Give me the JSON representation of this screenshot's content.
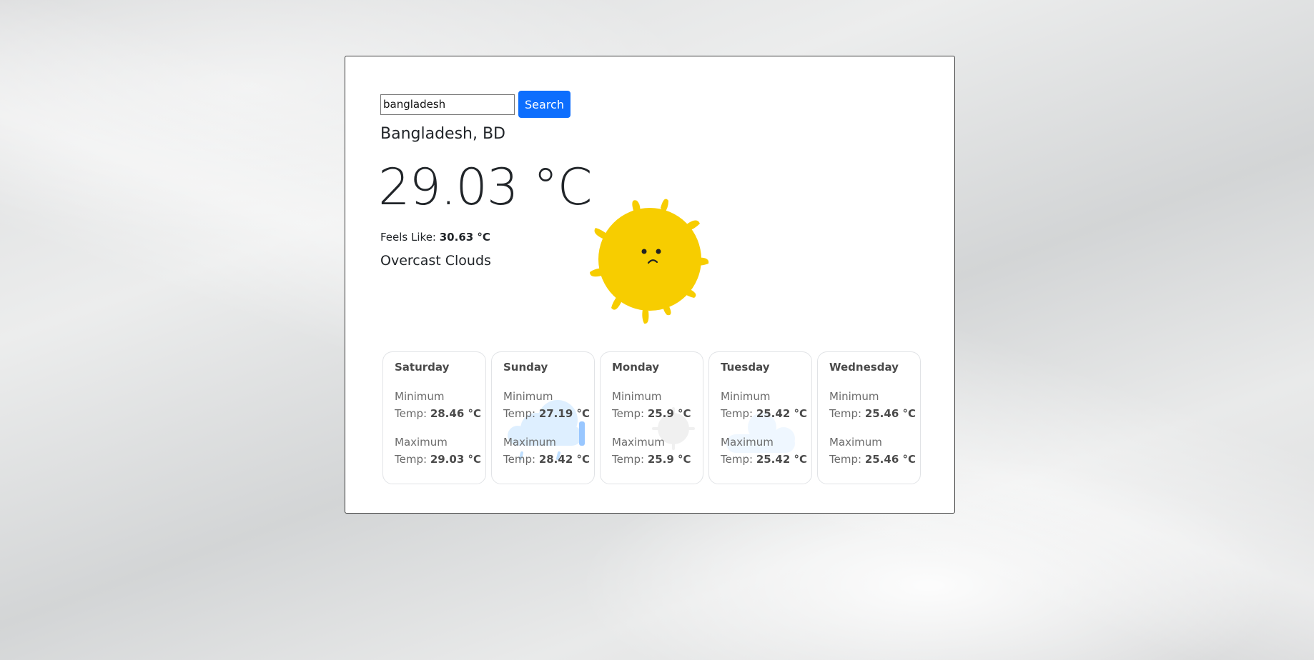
{
  "search": {
    "value": "bangladesh",
    "button_label": "Search"
  },
  "current": {
    "location": "Bangladesh, BD",
    "temperature": "29.03 °C",
    "feels_like_label": "Feels Like: ",
    "feels_like_value": "30.63 °C",
    "description": "Overcast Clouds",
    "icon": "sad-sun-icon",
    "icon_color": "#f7cd00"
  },
  "forecast": [
    {
      "day": "Saturday",
      "min_label": "Minimum",
      "min_prefix": "Temp: ",
      "min_temp": "28.46 °C",
      "max_label": "Maximum",
      "max_prefix": "Temp: ",
      "max_temp": "29.03 °C",
      "icon": "none"
    },
    {
      "day": "Sunday",
      "min_label": "Minimum",
      "min_prefix": "Temp: ",
      "min_temp": "27.19 °C",
      "max_label": "Maximum",
      "max_prefix": "Temp: ",
      "max_temp": "28.42 °C",
      "icon": "rain-cloud-icon"
    },
    {
      "day": "Monday",
      "min_label": "Minimum",
      "min_prefix": "Temp: ",
      "min_temp": "25.9 °C",
      "max_label": "Maximum",
      "max_prefix": "Temp: ",
      "max_temp": "25.9 °C",
      "icon": "sun-icon"
    },
    {
      "day": "Tuesday",
      "min_label": "Minimum",
      "min_prefix": "Temp: ",
      "min_temp": "25.42 °C",
      "max_label": "Maximum",
      "max_prefix": "Temp: ",
      "max_temp": "25.42 °C",
      "icon": "cloud-icon"
    },
    {
      "day": "Wednesday",
      "min_label": "Minimum",
      "min_prefix": "Temp: ",
      "min_temp": "25.46 °C",
      "max_label": "Maximum",
      "max_prefix": "Temp: ",
      "max_temp": "25.46 °C",
      "icon": "none"
    }
  ],
  "colors": {
    "accent": "#0d6efd",
    "sun": "#f7cd00",
    "cloud": "#cfe6ff"
  }
}
